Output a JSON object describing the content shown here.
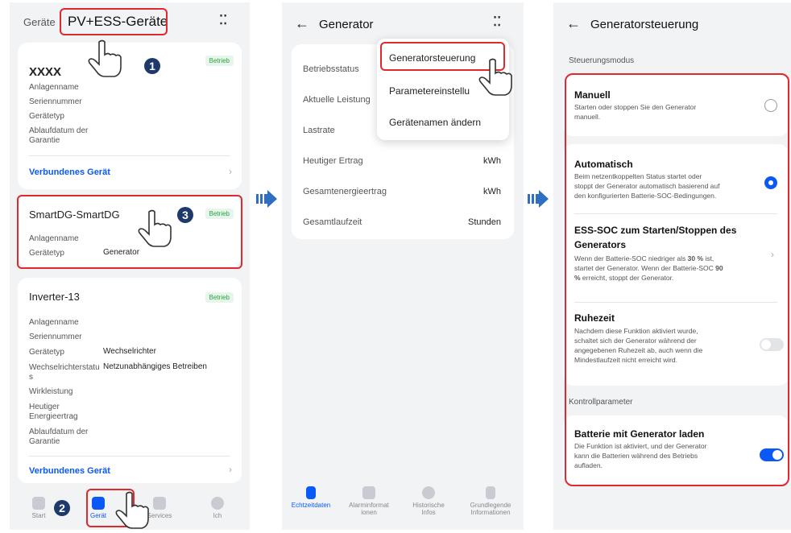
{
  "s1": {
    "tab_inactive": "Geräte",
    "tab_active": "PV+ESS-Geräte",
    "more": "⁚⁚",
    "card1": {
      "title": "XXXX",
      "badge": "Betrieb",
      "labels": [
        "Anlagenname",
        "Seriennummer",
        "Gerätetyp",
        "Ablaufdatum der",
        "Garantie"
      ],
      "link": "Verbundenes Gerät"
    },
    "card2": {
      "title": "SmartDG-SmartDG",
      "badge": "Betrieb",
      "label1": "Anlagenname",
      "label2": "Gerätetyp",
      "value2": "Generator"
    },
    "card3": {
      "title": "Inverter-13",
      "badge": "Betrieb",
      "l1": "Anlagenname",
      "l2": "Seriennummer",
      "l3": "Gerätetyp",
      "v3": "Wechselrichter",
      "l4a": "Wechselrichterstatu",
      "l4b": "s",
      "v4": "Netzunabhängiges Betreiben",
      "l5": "Wirkleistung",
      "l6a": "Heutiger",
      "l6b": "Energieertrag",
      "l7a": "Ablaufdatum der",
      "l7b": "Garantie",
      "link": "Verbundenes Gerät"
    },
    "nav": [
      "Start",
      "Gerät",
      "Services",
      "Ich"
    ],
    "steps": [
      "1",
      "2",
      "3"
    ]
  },
  "s2": {
    "title": "Generator",
    "rows": [
      {
        "label": "Betriebsstatus",
        "value": ""
      },
      {
        "label": "Aktuelle Leistung",
        "value": ""
      },
      {
        "label": "Lastrate",
        "value": ""
      },
      {
        "label": "Heutiger Ertrag",
        "value": "kWh"
      },
      {
        "label": "Gesamtenergieertrag",
        "value": "kWh"
      },
      {
        "label": "Gesamtlaufzeit",
        "value": "Stunden"
      }
    ],
    "menu": [
      "Generatorsteuerung",
      "Parametereinstellu",
      "Gerätenamen ändern"
    ],
    "nav": [
      "Echtzeitdaten",
      "Alarminformat",
      "ionen",
      "Historische",
      "Infos",
      "Grundlegende",
      "Informationen"
    ]
  },
  "s3": {
    "title": "Generatorsteuerung",
    "section1": "Steuerungsmodus",
    "manual_title": "Manuell",
    "manual_desc1": "Starten oder stoppen Sie den Generator",
    "manual_desc2": "manuell.",
    "auto_title": "Automatisch",
    "auto_desc1": "Beim netzentkoppelten Status startet oder",
    "auto_desc2": "stoppt der Generator automatisch basierend auf",
    "auto_desc3": "den konfigurierten Batterie-SOC-Bedingungen.",
    "soc_title1": "ESS-SOC zum Starten/Stoppen des",
    "soc_title2": "Generators",
    "soc_desc1a": "Wenn der Batterie-SOC niedriger als ",
    "soc_desc1b": "30 %",
    "soc_desc1c": " ist,",
    "soc_desc2a": "startet der Generator. Wenn der Batterie-SOC ",
    "soc_desc2b": "90",
    "soc_desc3a": "%",
    "soc_desc3b": " erreicht, stoppt der Generator.",
    "rest_title": "Ruhezeit",
    "rest_desc1": "Nachdem diese Funktion aktiviert wurde,",
    "rest_desc2": "schaltet sich der Generator während der",
    "rest_desc3": "angegebenen Ruhezeit ab, auch wenn die",
    "rest_desc4": "Mindestlaufzeit nicht erreicht wird.",
    "section2": "Kontrollparameter",
    "charge_title": "Batterie mit Generator laden",
    "charge_desc1": "Die Funktion ist aktiviert, und der Generator",
    "charge_desc2": "kann die Batterien während des Betriebs",
    "charge_desc3": "aufladen."
  },
  "colors": {
    "accent": "#0a59f7",
    "highlight": "#e0282e",
    "step": "#1e3a6b",
    "running": "#2ea043"
  }
}
